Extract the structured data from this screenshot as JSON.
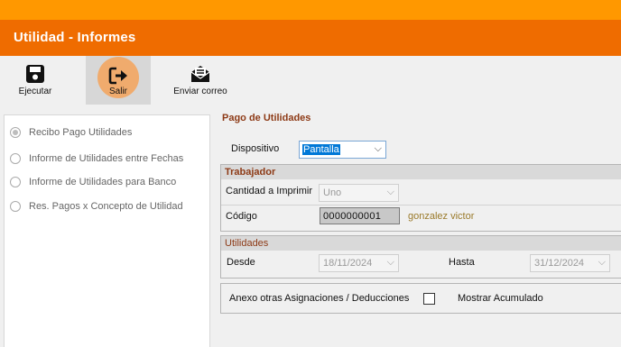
{
  "window": {
    "title": "Utilidad - Informes"
  },
  "toolbar": {
    "ejecutar_label": "Ejecutar",
    "salir_label": "Salir",
    "correo_label": "Enviar correo"
  },
  "report_options": [
    {
      "label": "Recibo Pago Utilidades",
      "checked": true
    },
    {
      "label": "Informe de Utilidades entre Fechas",
      "checked": false
    },
    {
      "label": "Informe de Utilidades para Banco",
      "checked": false
    },
    {
      "label": "Res. Pagos x Concepto de Utilidad",
      "checked": false
    }
  ],
  "form": {
    "section_title": "Pago de Utilidades",
    "dispositivo": {
      "label": "Dispositivo",
      "value": "Pantalla"
    },
    "trabajador": {
      "header": "Trabajador",
      "cantidad_label": "Cantidad a Imprimir",
      "cantidad_value": "Uno",
      "codigo_label": "Código",
      "codigo_value": "0000000001",
      "nombre": "gonzalez victor"
    },
    "utilidades": {
      "header": "Utilidades",
      "desde_label": "Desde",
      "desde_value": "18/11/2024",
      "hasta_label": "Hasta",
      "hasta_value": "31/12/2024"
    },
    "anexo_label": "Anexo otras Asignaciones / Deducciones",
    "anexo_checked": false,
    "mostrar_acumulado_label": "Mostrar Acumulado"
  }
}
